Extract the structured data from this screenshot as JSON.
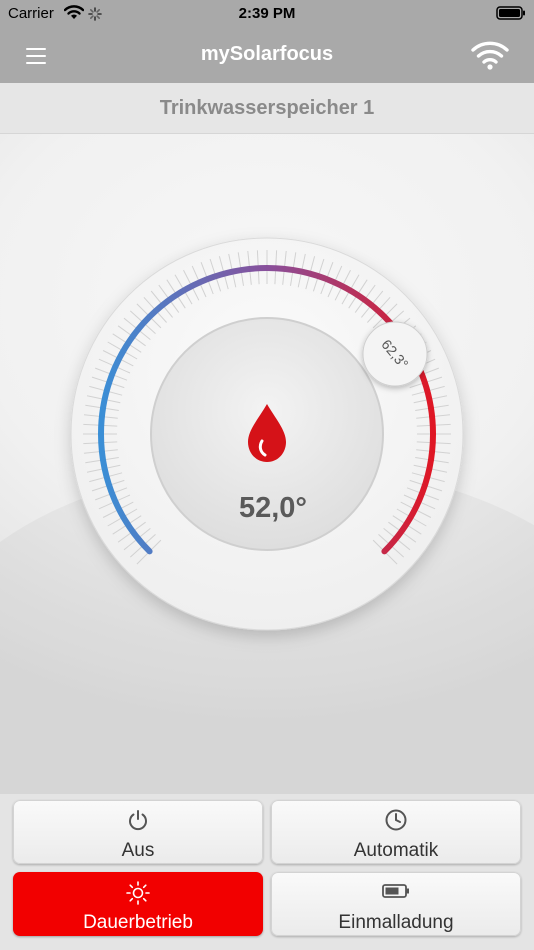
{
  "status_bar": {
    "carrier": "Carrier",
    "time": "2:39 PM"
  },
  "nav": {
    "title": "mySolarfocus"
  },
  "section": {
    "title": "Trinkwasserspeicher 1"
  },
  "gauge": {
    "current_temperature": "52,0°",
    "setpoint_label": "62,3°",
    "cold_color": "#3a8fd6",
    "hot_color": "#e3141f"
  },
  "modes": {
    "aus": {
      "label": "Aus",
      "icon": "power-icon"
    },
    "automatik": {
      "label": "Automatik",
      "icon": "clock-icon"
    },
    "dauerbetrieb": {
      "label": "Dauerbetrieb",
      "icon": "sun-icon",
      "active": true
    },
    "einmalladung": {
      "label": "Einmalladung",
      "icon": "battery-icon"
    }
  },
  "colors": {
    "active_mode": "#f20000",
    "header_bar": "#a9a9a9"
  }
}
